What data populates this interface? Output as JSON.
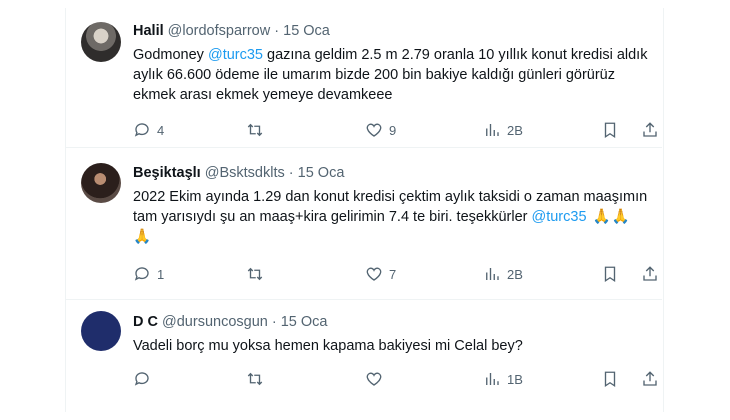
{
  "tweets": [
    {
      "name": "Halil",
      "handle": "@lordofsparrow",
      "dot": "·",
      "date": "15 Oca",
      "text_pre": "Godmoney ",
      "mention": "@turc35",
      "text_post": " gazına geldim 2.5 m 2.79 oranla 10 yıllık konut kredisi aldık aylık 66.600 ödeme ile umarım bizde 200 bin bakiye kaldığı günleri görürüz ekmek arası ekmek yemeye devamkeee",
      "emoji": "",
      "replies": "4",
      "retweets": "",
      "likes": "9",
      "views": "2B"
    },
    {
      "name": "Beşiktaşlı",
      "handle": "@Bsktsdklts",
      "dot": "·",
      "date": "15 Oca",
      "text_pre": "2022 Ekim ayında 1.29 dan konut kredisi çektim aylık taksidi o zaman maaşımın tam yarısıydı şu an maaş+kira gelirimin 7.4 te biri. teşekkürler ",
      "mention": "@turc35",
      "text_post": "",
      "emoji": "🙏🙏🙏",
      "replies": "1",
      "retweets": "",
      "likes": "7",
      "views": "2B"
    },
    {
      "name": "D C",
      "handle": "@dursuncosgun",
      "dot": "·",
      "date": "15 Oca",
      "text_pre": "Vadeli borç mu yoksa hemen kapama bakiyesi mi Celal bey?",
      "mention": "",
      "text_post": "",
      "emoji": "",
      "replies": "",
      "retweets": "",
      "likes": "",
      "views": "1B"
    }
  ],
  "icons": [
    "reply-icon",
    "retweet-icon",
    "like-icon",
    "views-icon",
    "bookmark-icon",
    "share-icon"
  ]
}
